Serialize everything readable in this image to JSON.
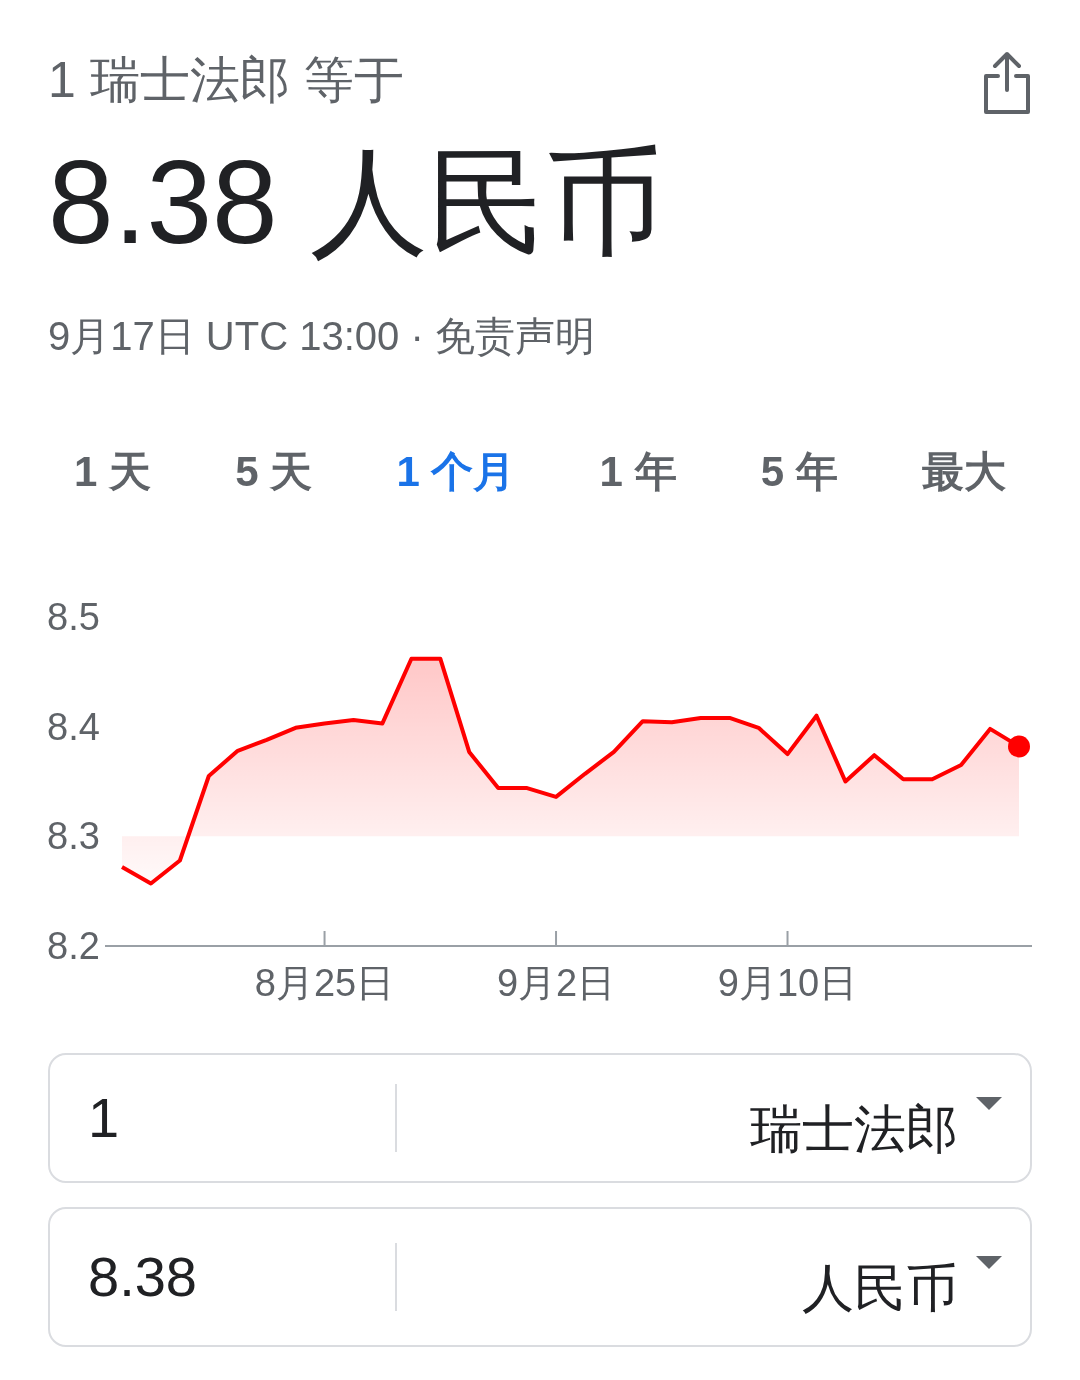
{
  "header": {
    "caption": "1 瑞士法郎 等于",
    "result": "8.38 人民币"
  },
  "meta": {
    "timestamp": "9月17日 UTC 13:00",
    "separator": "·",
    "disclaimer": "免责声明"
  },
  "ranges": [
    {
      "label": "1 天",
      "selected": false
    },
    {
      "label": "5 天",
      "selected": false
    },
    {
      "label": "1 个月",
      "selected": true
    },
    {
      "label": "1 年",
      "selected": false
    },
    {
      "label": "5 年",
      "selected": false
    },
    {
      "label": "最大",
      "selected": false
    }
  ],
  "chart_data": {
    "type": "line",
    "categories": [
      null,
      null,
      null,
      null,
      null,
      null,
      null,
      "8月25日",
      null,
      null,
      null,
      null,
      null,
      null,
      null,
      "9月2日",
      null,
      null,
      null,
      null,
      null,
      null,
      null,
      "9月10日",
      null,
      null,
      null,
      null,
      null,
      null,
      null,
      null
    ],
    "series": [
      {
        "color": "#ff0000",
        "values": [
          8.272,
          8.257,
          8.278,
          8.355,
          8.378,
          8.388,
          8.399,
          8.403,
          8.406,
          8.403,
          8.462,
          8.462,
          8.377,
          8.344,
          8.344,
          8.336,
          8.357,
          8.377,
          8.405,
          8.404,
          8.408,
          8.408,
          8.399,
          8.375,
          8.41,
          8.35,
          8.374,
          8.352,
          8.352,
          8.365,
          8.398,
          8.382
        ]
      }
    ],
    "ylim": [
      8.2,
      8.5
    ],
    "yticks": [
      {
        "value": 8.2,
        "label": "8.2"
      },
      {
        "value": 8.3,
        "label": "8.3"
      },
      {
        "value": 8.4,
        "label": "8.4"
      },
      {
        "value": 8.5,
        "label": "8.5"
      }
    ]
  },
  "converter": [
    {
      "amount": "1",
      "currency": "瑞士法郎"
    },
    {
      "amount": "8.38",
      "currency": "人民币"
    }
  ]
}
